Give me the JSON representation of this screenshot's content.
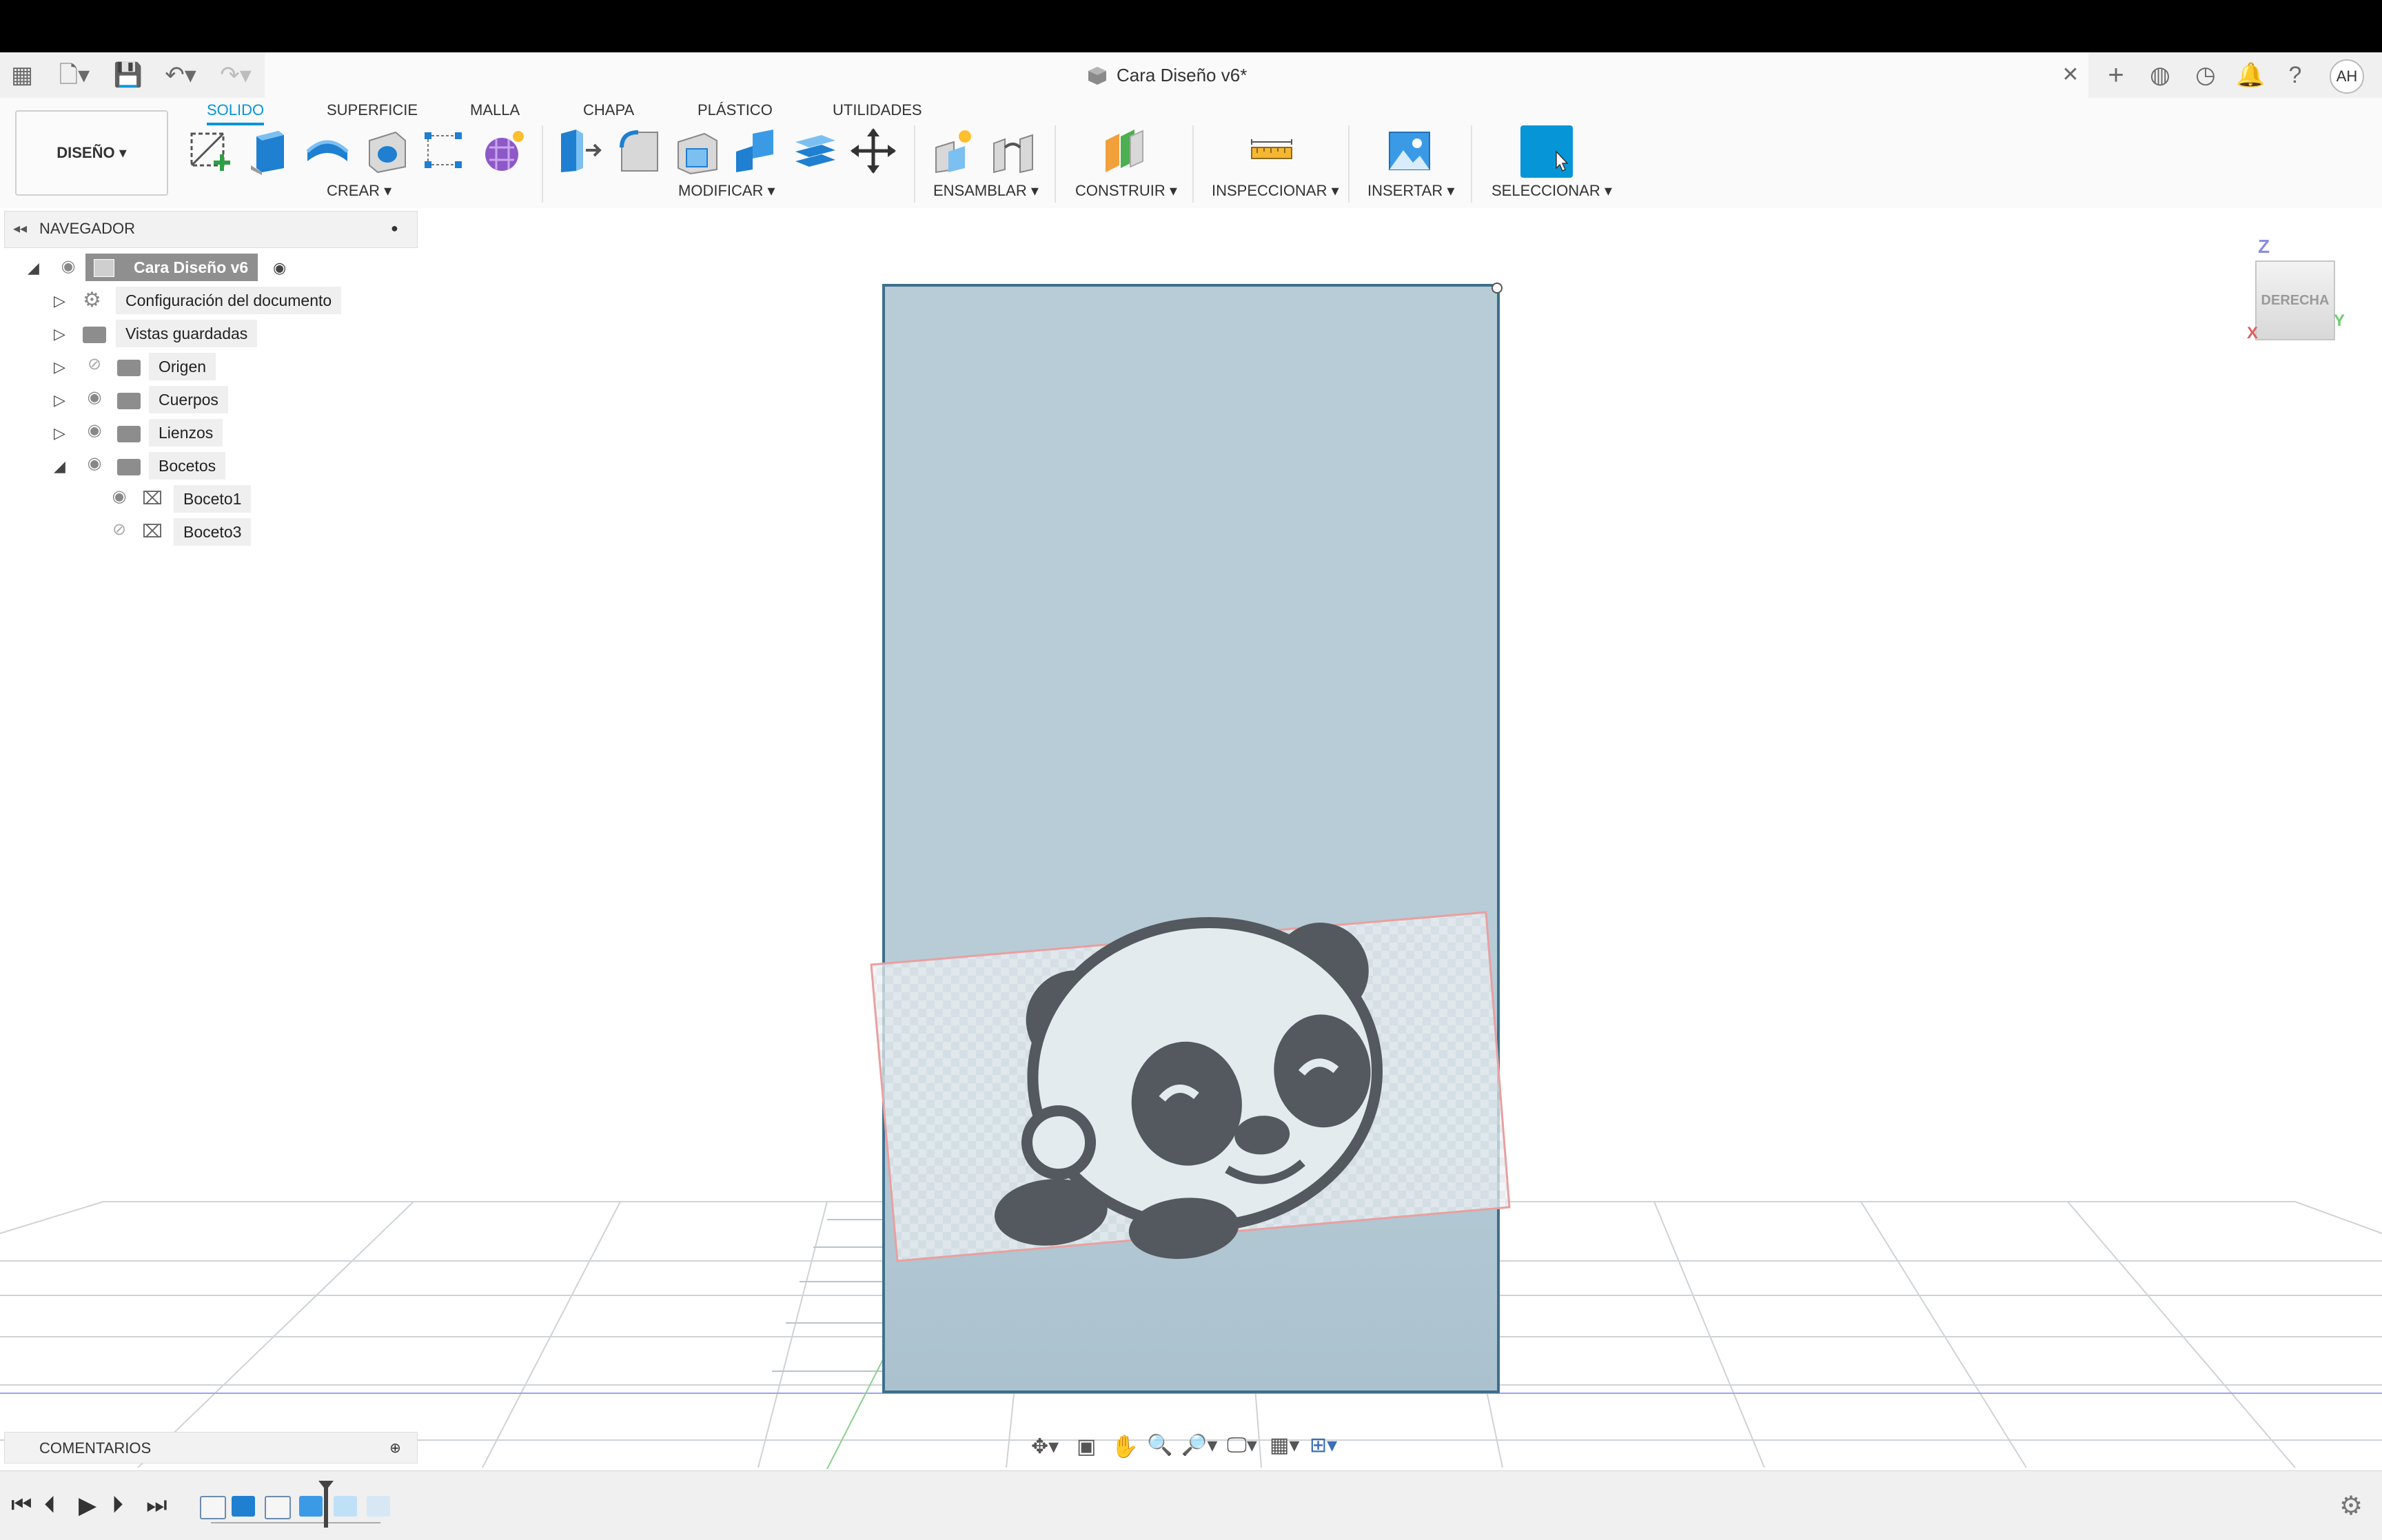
{
  "window": {
    "title": "Cara Diseño v6*"
  },
  "user": {
    "initials": "AH"
  },
  "workspace": {
    "label": "DISEÑO ▾"
  },
  "ribbon": {
    "tabs": [
      {
        "label": "SOLIDO",
        "active": true
      },
      {
        "label": "SUPERFICIE",
        "active": false
      },
      {
        "label": "MALLA",
        "active": false
      },
      {
        "label": "CHAPA",
        "active": false
      },
      {
        "label": "PLÁSTICO",
        "active": false
      },
      {
        "label": "UTILIDADES",
        "active": false
      }
    ],
    "groups": {
      "crear": "CREAR ▾",
      "modificar": "MODIFICAR ▾",
      "ensamblar": "ENSAMBLAR ▾",
      "construir": "CONSTRUIR ▾",
      "inspeccionar": "INSPECCIONAR ▾",
      "insertar": "INSERTAR ▾",
      "seleccionar": "SELECCIONAR ▾"
    },
    "accent_color": "#0696d7"
  },
  "navigator": {
    "title": "NAVEGADOR",
    "root": "Cara Diseño v6",
    "items": [
      {
        "label": "Configuración del documento",
        "icon": "gear-icon"
      },
      {
        "label": "Vistas guardadas",
        "icon": "folder-icon"
      },
      {
        "label": "Origen",
        "icon": "folder-icon",
        "visible": false
      },
      {
        "label": "Cuerpos",
        "icon": "folder-icon",
        "visible": true
      },
      {
        "label": "Lienzos",
        "icon": "folder-icon",
        "visible": true
      },
      {
        "label": "Bocetos",
        "icon": "folder-icon",
        "visible": true,
        "expanded": true
      }
    ],
    "sketches": [
      {
        "label": "Boceto1",
        "visible": true
      },
      {
        "label": "Boceto3",
        "visible": false
      }
    ]
  },
  "comments": {
    "title": "COMENTARIOS"
  },
  "viewcube": {
    "face": "DERECHA",
    "axes": {
      "z": "Z",
      "y": "Y",
      "x": "X"
    }
  },
  "colors": {
    "body_fill": "#b7ccd6",
    "body_edge": "#3e6f8c",
    "canvas_outline": "#e8a0a0",
    "panda_dark": "#53595e"
  }
}
